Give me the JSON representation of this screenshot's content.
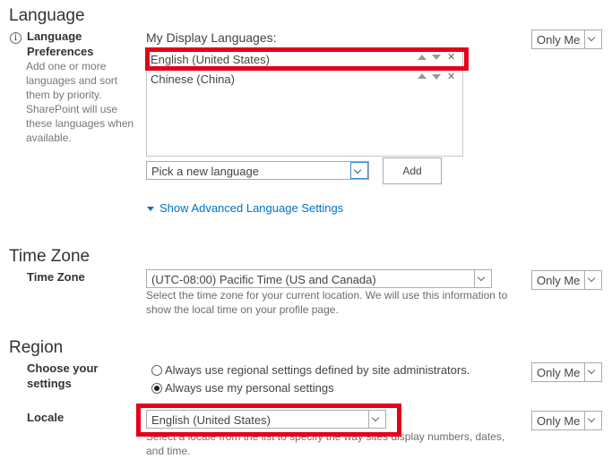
{
  "language_section": {
    "title": "Language",
    "label": "Language Preferences",
    "description_lines": [
      "Add one or more",
      "languages and sort",
      "them by priority.",
      "SharePoint will use",
      "these languages when",
      "available."
    ],
    "display_languages_label": "My Display Languages:",
    "languages": [
      "English (United States)",
      "Chinese (China)"
    ],
    "pick_placeholder": "Pick a new language",
    "add_label": "Add",
    "advanced_link": "Show Advanced Language Settings",
    "privacy": "Only Me"
  },
  "timezone_section": {
    "title": "Time Zone",
    "label": "Time Zone",
    "value": "(UTC-08:00) Pacific Time (US and Canada)",
    "description_lines": [
      "Select the time zone for your current location. We will use this information to",
      "show the local time on your profile page."
    ],
    "privacy": "Only Me"
  },
  "region_section": {
    "title": "Region",
    "choose_label_lines": [
      "Choose your",
      "settings"
    ],
    "options": [
      "Always use regional settings defined by site administrators.",
      "Always use my personal settings"
    ],
    "selected_option": 1,
    "privacy": "Only Me",
    "locale_label": "Locale",
    "locale_value": "English (United States)",
    "locale_description_lines": [
      "Select a locale from the list to specify the way sites display numbers, dates,",
      "and time."
    ],
    "locale_privacy": "Only Me"
  },
  "colors": {
    "highlight": "#e3001b",
    "link": "#0072c6"
  },
  "icons": {
    "info": "info-icon",
    "move_up": "arrow-up-icon",
    "move_down": "arrow-down-icon",
    "remove": "close-icon"
  }
}
